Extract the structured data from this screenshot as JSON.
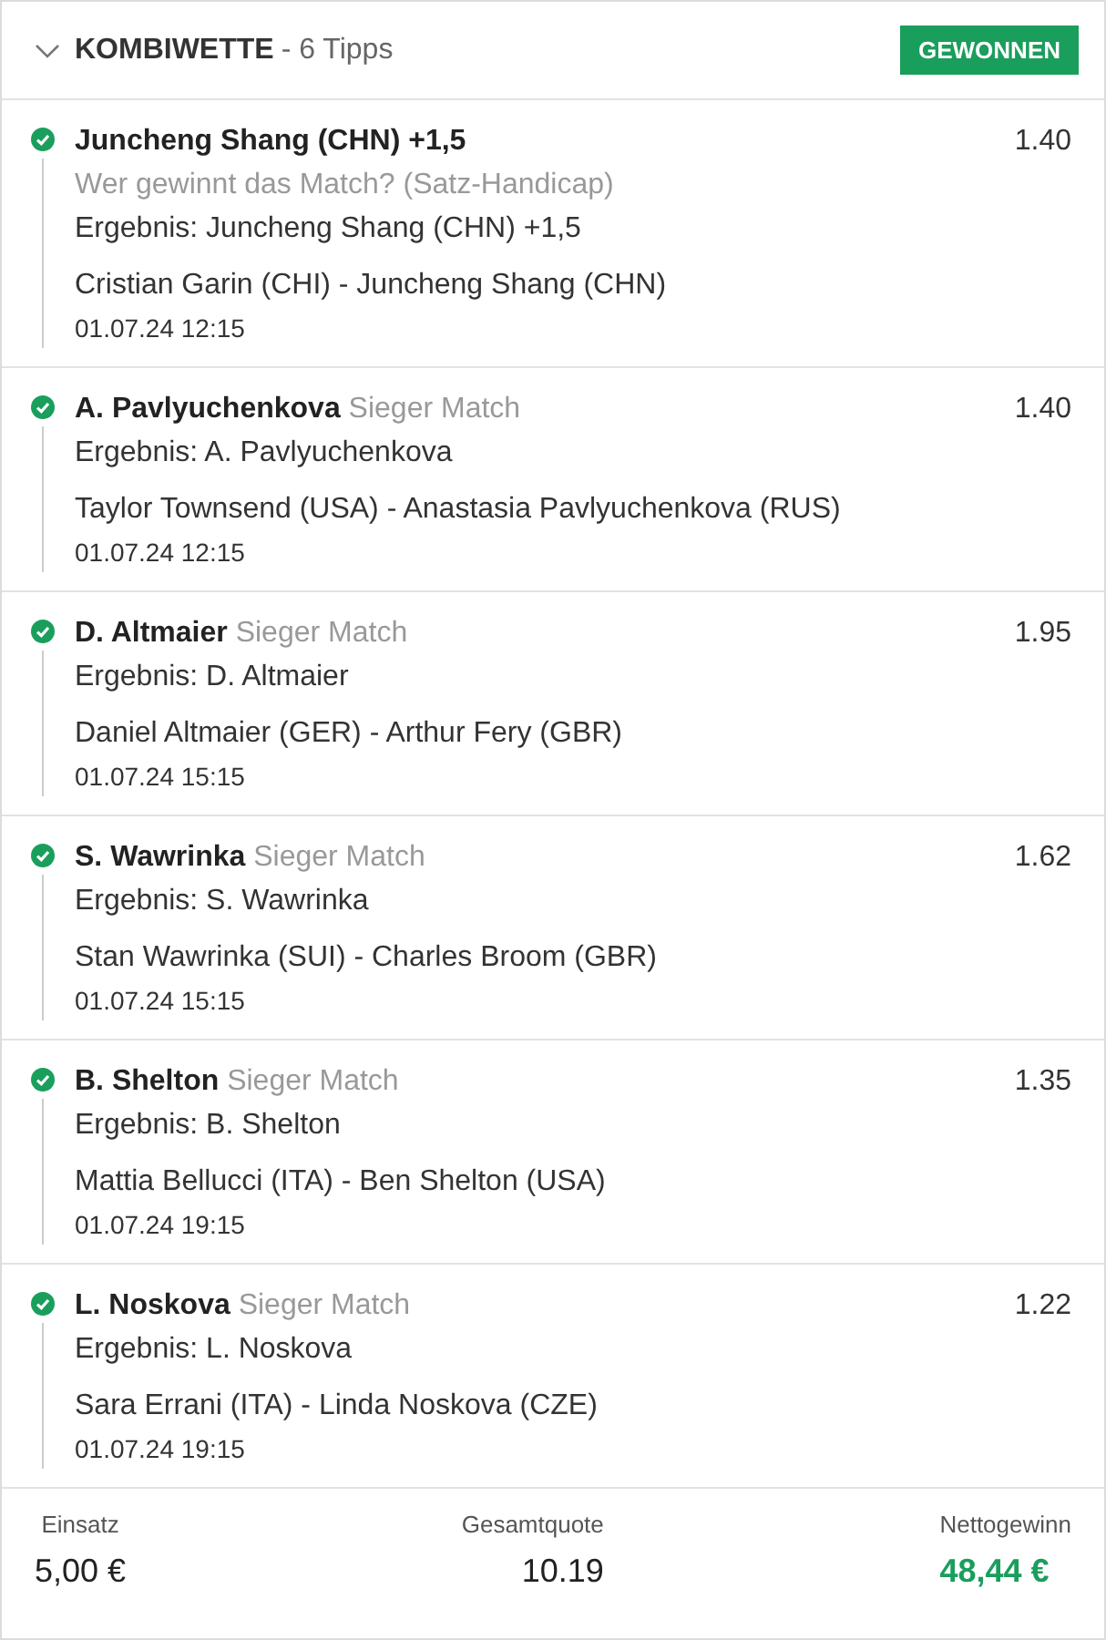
{
  "header": {
    "expanded": true,
    "title": "KOMBIWETTE",
    "subtitle": "- 6 Tipps",
    "status": "GEWONNEN"
  },
  "tips": [
    {
      "kind": "stacked",
      "won": true,
      "pick": "Juncheng Shang (CHN) +1,5",
      "market": "Wer gewinnt das Match? (Satz-Handicap)",
      "result": "Ergebnis: Juncheng Shang (CHN) +1,5",
      "match": "Cristian Garin (CHI) - Juncheng Shang (CHN)",
      "date": "01.07.24 12:15",
      "odds": "1.40"
    },
    {
      "kind": "inline",
      "won": true,
      "pick": "A. Pavlyuchenkova",
      "market": "Sieger Match",
      "result": "Ergebnis: A. Pavlyuchenkova",
      "match": "Taylor Townsend (USA) - Anastasia Pavlyuchenkova (RUS)",
      "date": "01.07.24 12:15",
      "odds": "1.40"
    },
    {
      "kind": "inline",
      "won": true,
      "pick": "D. Altmaier",
      "market": "Sieger Match",
      "result": "Ergebnis: D. Altmaier",
      "match": "Daniel Altmaier (GER) - Arthur Fery (GBR)",
      "date": "01.07.24 15:15",
      "odds": "1.95"
    },
    {
      "kind": "inline",
      "won": true,
      "pick": "S. Wawrinka",
      "market": "Sieger Match",
      "result": "Ergebnis: S. Wawrinka",
      "match": "Stan Wawrinka (SUI) - Charles Broom (GBR)",
      "date": "01.07.24 15:15",
      "odds": "1.62"
    },
    {
      "kind": "inline",
      "won": true,
      "pick": "B. Shelton",
      "market": "Sieger Match",
      "result": "Ergebnis: B. Shelton",
      "match": "Mattia Bellucci (ITA) - Ben Shelton (USA)",
      "date": "01.07.24 19:15",
      "odds": "1.35"
    },
    {
      "kind": "inline",
      "won": true,
      "pick": "L. Noskova",
      "market": "Sieger Match",
      "result": "Ergebnis: L. Noskova",
      "match": "Sara Errani (ITA) - Linda Noskova (CZE)",
      "date": "01.07.24 19:15",
      "odds": "1.22"
    }
  ],
  "summary": {
    "stake_label": "Einsatz",
    "stake": "5,00 €",
    "total_odds_label": "Gesamtquote",
    "total_odds": "10.19",
    "net_win_label": "Nettogewinn",
    "net_win": "48,44 €"
  }
}
